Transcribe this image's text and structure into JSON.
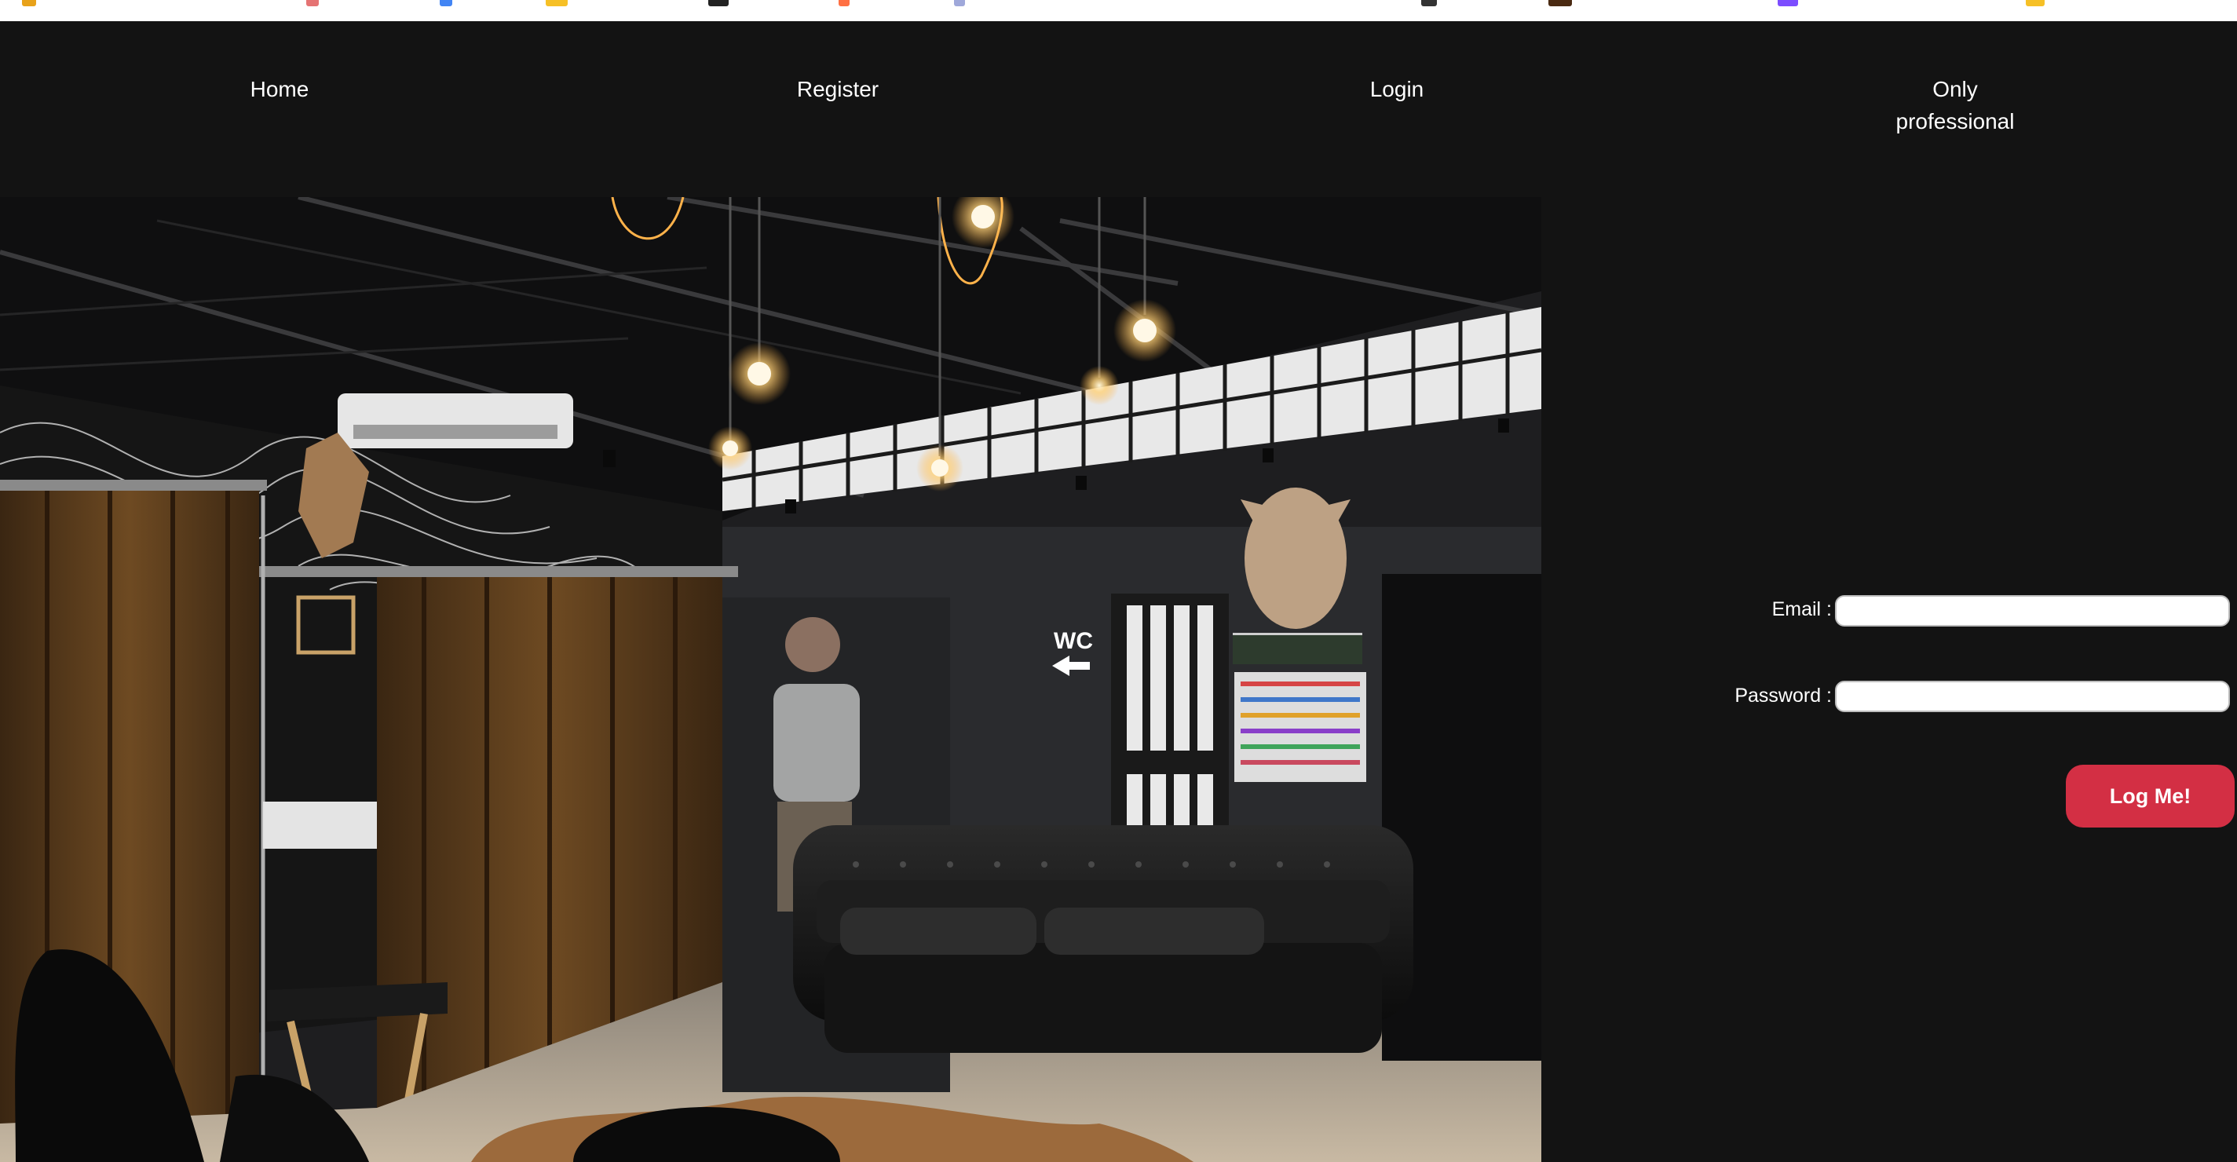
{
  "nav": {
    "items": [
      {
        "label_line1": "Home",
        "label_line2": ""
      },
      {
        "label_line1": "Register",
        "label_line2": ""
      },
      {
        "label_line1": "Login",
        "label_line2": ""
      },
      {
        "label_line1": "Only",
        "label_line2": "professional"
      }
    ]
  },
  "hero": {
    "wc_sign": "WC"
  },
  "login_form": {
    "email_label": "Email :",
    "email_value": "",
    "password_label": "Password :",
    "password_value": "",
    "submit_label": "Log Me!"
  },
  "colors": {
    "page_background": "#131313",
    "button_accent": "#d32f44",
    "text": "#ffffff"
  }
}
